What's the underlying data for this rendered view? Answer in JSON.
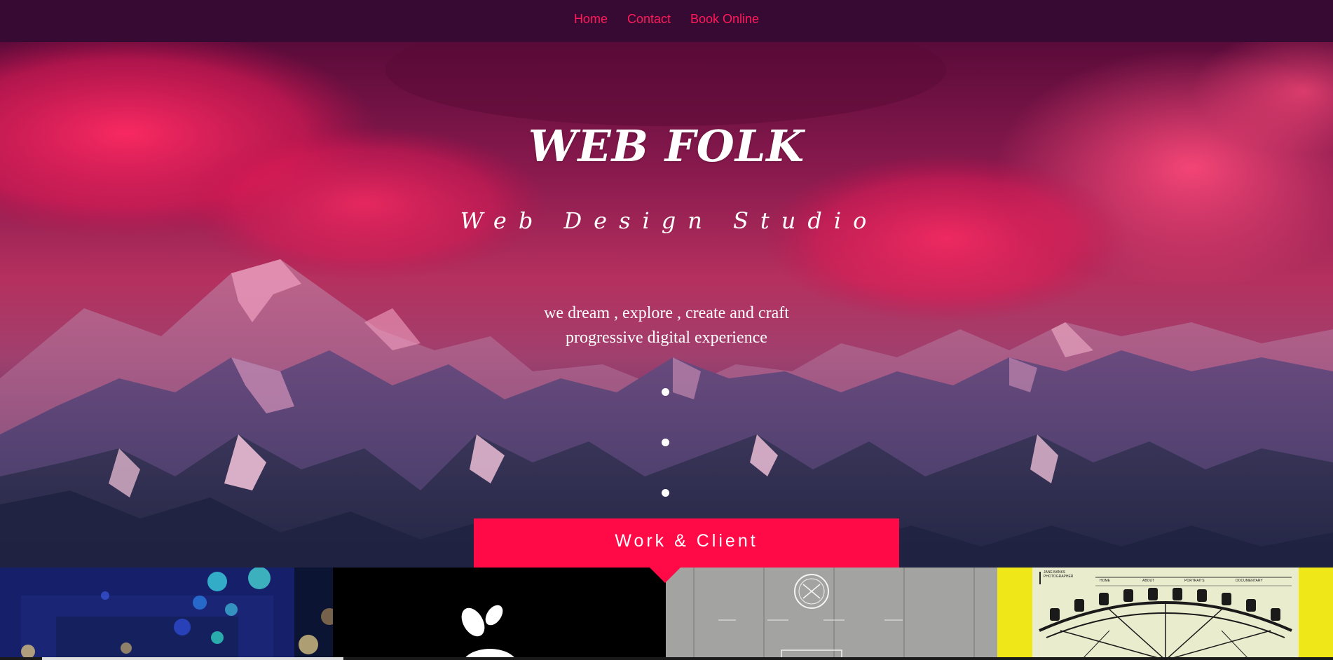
{
  "nav": {
    "items": [
      "Home",
      "Contact",
      "Book Online"
    ]
  },
  "hero": {
    "title": "WEB FOLK",
    "subtitle": "Web Design Studio",
    "tagline_line1": "we dream , explore , create and craft",
    "tagline_line2": "progressive digital experience"
  },
  "work_button": {
    "label": "Work & Client"
  },
  "gallery": {
    "tiles": [
      {
        "name": "bokeh-lights-thumbnail"
      },
      {
        "name": "apple-logo-thumbnail"
      },
      {
        "name": "concrete-wall-site-thumbnail"
      },
      {
        "name": "ferris-wheel-photographer-thumbnail",
        "caption": "JANE BANKS PHOTOGRAPHER",
        "menu": [
          "HOME",
          "ABOUT",
          "PORTRAITS",
          "DOCUMENTARY"
        ]
      }
    ]
  },
  "colors": {
    "nav_bg": "#370a33",
    "nav_link": "#ff1a5a",
    "accent": "#ff0a47"
  }
}
